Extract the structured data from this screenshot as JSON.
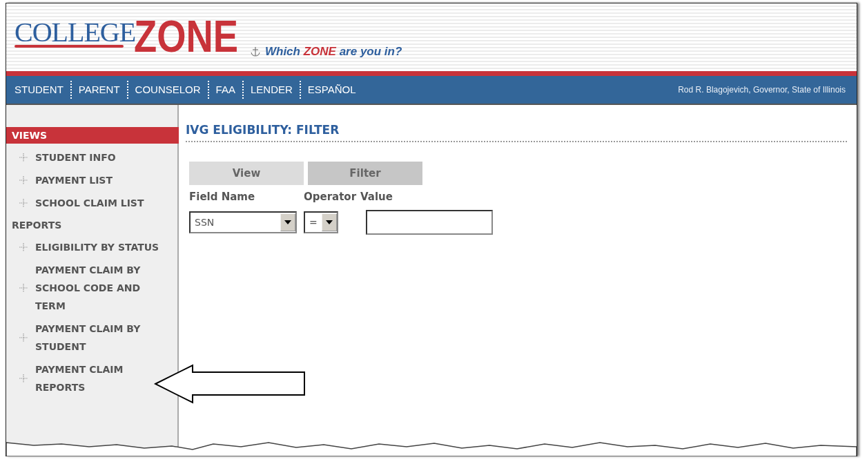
{
  "header": {
    "logo": {
      "first": "COLLEGE",
      "second": "ZONE"
    },
    "tagline": {
      "before": "Which",
      "highlight": "ZONE",
      "after": "are you in?"
    }
  },
  "nav": {
    "links": [
      "STUDENT",
      "PARENT",
      "COUNSELOR",
      "FAA",
      "LENDER",
      "ESPAÑOL"
    ],
    "credit": "Rod R. Blagojevich, Governor, State of Illinois"
  },
  "sidebar": {
    "sections": [
      {
        "title": "VIEWS",
        "selected": true,
        "items": [
          "STUDENT INFO",
          "PAYMENT LIST",
          "SCHOOL CLAIM LIST"
        ]
      },
      {
        "title": "REPORTS",
        "selected": false,
        "items": [
          "ELIGIBILITY BY STATUS",
          "PAYMENT CLAIM BY SCHOOL CODE AND TERM",
          "PAYMENT CLAIM BY STUDENT",
          "PAYMENT CLAIM REPORTS"
        ]
      }
    ]
  },
  "main": {
    "title": "IVG ELIGIBILITY: FILTER",
    "tabs": [
      {
        "label": "View",
        "selected": false
      },
      {
        "label": "Filter",
        "selected": true
      }
    ],
    "filter": {
      "labels": [
        "Field Name",
        "Operator",
        "Value"
      ],
      "field_name": "SSN",
      "operator": "="
    }
  }
}
